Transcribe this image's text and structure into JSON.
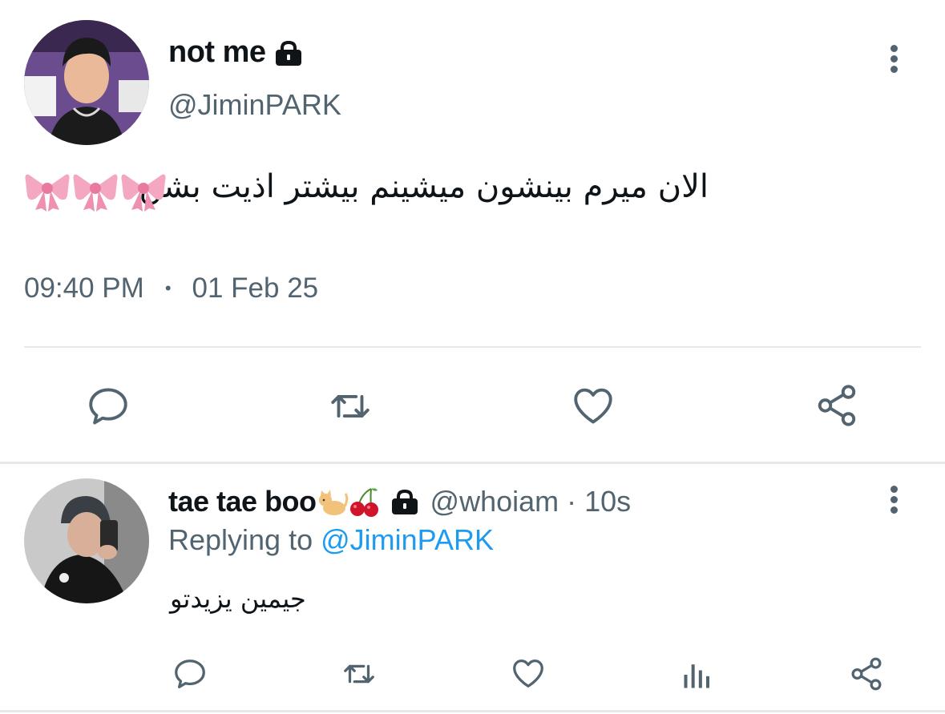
{
  "main_tweet": {
    "display_name": "not me",
    "handle": "@JiminPARK",
    "text": "الان میرم بینشون میشینم بیشتر اذیت بشن",
    "emoji": [
      "bow-emoji",
      "bow-emoji",
      "bow-emoji"
    ],
    "time": "09:40 PM",
    "separator": "•",
    "date": "01 Feb 25",
    "actions": [
      "reply-icon",
      "retweet-icon",
      "like-icon",
      "share-icon"
    ]
  },
  "reply_tweet": {
    "display_name": "tae tae boo",
    "name_emoji": [
      "cat-emoji",
      "cherries-emoji"
    ],
    "handle": "@whoiam",
    "time_ago": "· 10s",
    "replying_prefix": "Replying to",
    "replying_to": "@JiminPARK",
    "text": "جیمین یزیدتو",
    "actions": [
      "reply-icon",
      "retweet-icon",
      "like-icon",
      "analytics-icon",
      "share-icon"
    ]
  },
  "colors": {
    "text_primary": "#0f1419",
    "text_secondary": "#536471",
    "link": "#1d9bf0",
    "divider": "#e6e9ec"
  }
}
